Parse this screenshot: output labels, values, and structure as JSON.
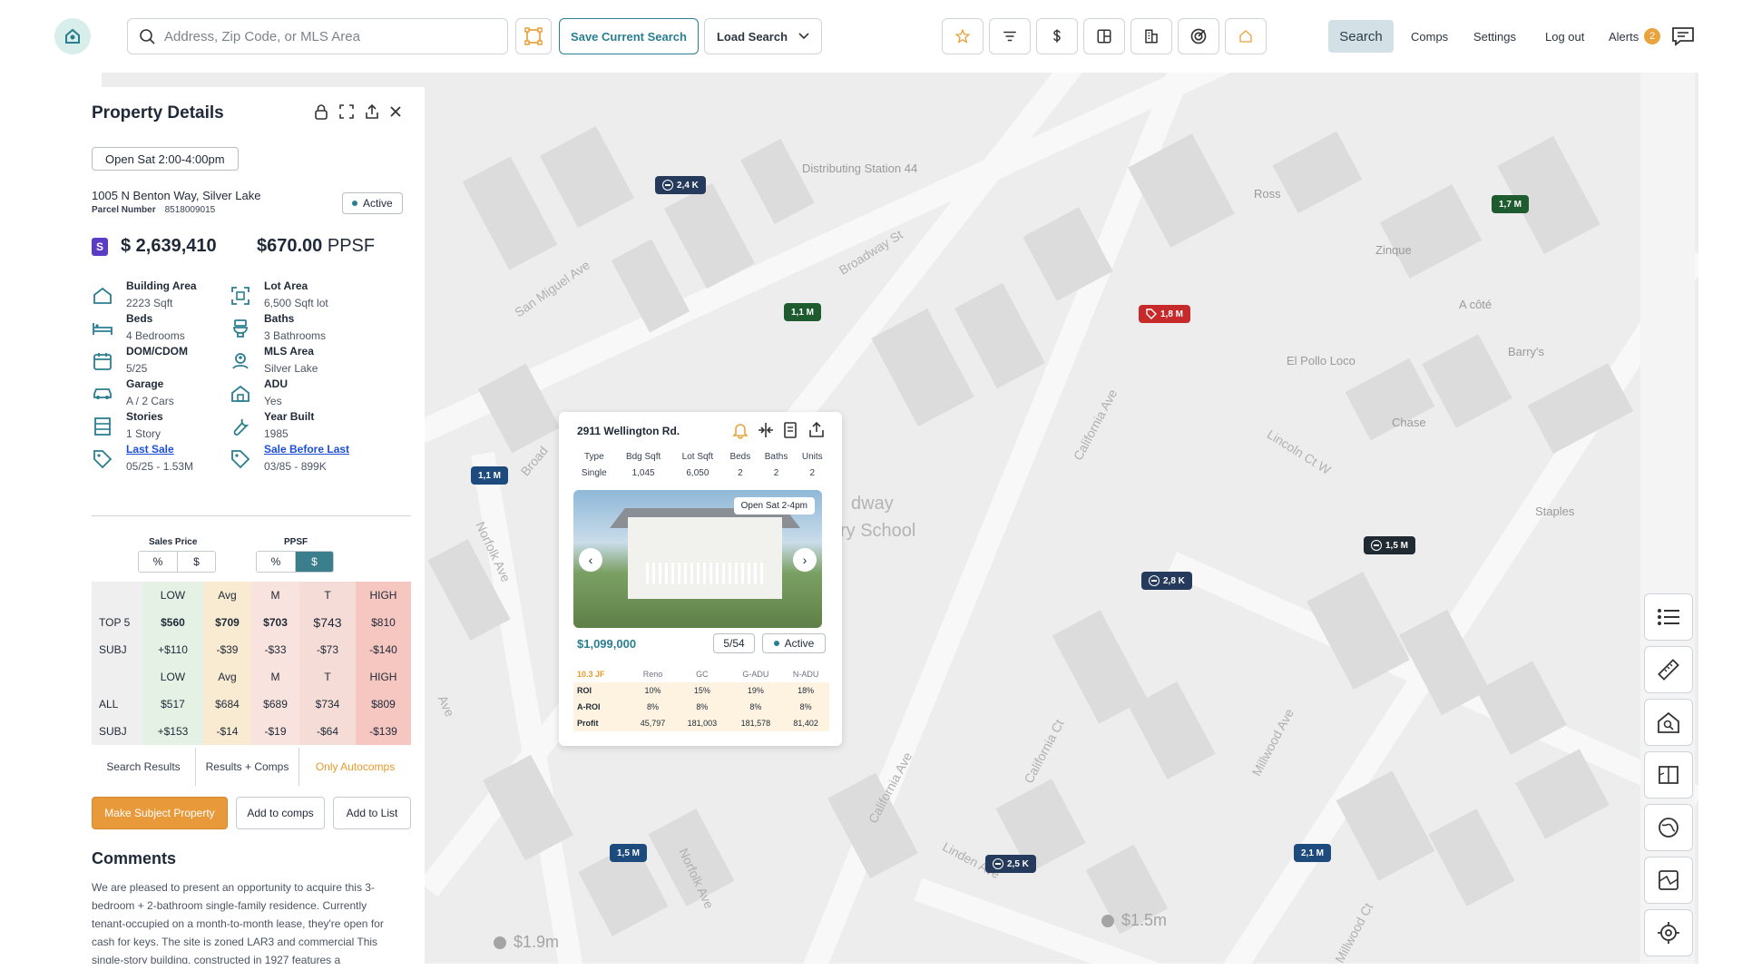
{
  "header": {
    "search_placeholder": "Address, Zip Code, or MLS Area",
    "save_search": "Save Current Search",
    "load_search": "Load Search",
    "nav": {
      "search": "Search",
      "comps": "Comps",
      "settings": "Settings",
      "logout": "Log out",
      "alerts": "Alerts",
      "alerts_count": "2"
    },
    "tools": [
      "star-icon",
      "filter-icon",
      "dollar-icon",
      "layout-icon",
      "building-icon",
      "target-icon",
      "home-outline-icon"
    ]
  },
  "property": {
    "title": "Property Details",
    "open_house": "Open Sat 2:00-4:00pm",
    "address": "1005 N Benton Way, Silver Lake",
    "parcel_label": "Parcel Number",
    "parcel_number": "8518009015",
    "status": "Active",
    "price_badge": "S",
    "price": "$ 2,639,410",
    "ppsf_value": "$670.00",
    "ppsf_unit": "PPSF",
    "details": [
      {
        "label": "Building Area",
        "value": "2223 Sqft"
      },
      {
        "label": "Lot Area",
        "value": "6,500 Sqft lot"
      },
      {
        "label": "Beds",
        "value": "4 Bedrooms"
      },
      {
        "label": "Baths",
        "value": "3 Bathrooms"
      },
      {
        "label": "DOM/CDOM",
        "value": "5/25"
      },
      {
        "label": "MLS Area",
        "value": "Silver Lake"
      },
      {
        "label": "Garage",
        "value": "A / 2 Cars"
      },
      {
        "label": "ADU",
        "value": "Yes"
      },
      {
        "label": "Stories",
        "value": "1 Story"
      },
      {
        "label": "Year Built",
        "value": "1985"
      },
      {
        "label": "Last Sale",
        "value": "05/25 - 1.53M"
      },
      {
        "label": "Sale Before Last",
        "value": "03/85 - 899K"
      }
    ],
    "sales_price_label": "Sales Price",
    "ppsf_label": "PPSF",
    "toggle_pct": "%",
    "toggle_usd": "$",
    "stats": {
      "header": [
        "LOW",
        "Avg",
        "M",
        "T",
        "HIGH"
      ],
      "rows": [
        {
          "label": "TOP 5",
          "values": [
            "$560",
            "$709",
            "$703",
            "$743",
            "$810"
          ]
        },
        {
          "label": "SUBJ",
          "values": [
            "+$110",
            "-$39",
            "-$33",
            "-$73",
            "-$140"
          ]
        },
        {
          "label": "ALL",
          "values": [
            "$517",
            "$684",
            "$689",
            "$734",
            "$809"
          ]
        },
        {
          "label": "SUBJ",
          "values": [
            "+$153",
            "-$14",
            "-$19",
            "-$64",
            "-$139"
          ]
        }
      ]
    },
    "tabs": [
      "Search Results",
      "Results + Comps",
      "Only Autocomps"
    ],
    "buttons": {
      "make_subject": "Make Subject Property",
      "add_comps": "Add to comps",
      "add_list": "Add to List"
    },
    "comments_title": "Comments",
    "comments": "We are pleased to present an opportunity to acquire this 3-bedroom + 2-bathroom single-family residence. Currently tenant-occupied on a month-to-month lease, they're open for cash for keys. The site is zoned LAR3 and commercial This single-story building, constructed in 1927 features a"
  },
  "map": {
    "markers": [
      "2,4 K",
      "1,7 M",
      "1,1 M",
      "1,8 M",
      "1,1 M",
      "1,5 M",
      "2,8 K",
      "1,5 M",
      "2,5 K",
      "2,1 M"
    ],
    "streets": [
      "San Miguel Ave",
      "Broadway St",
      "Broad",
      "Norfolk Ave",
      "California Ave",
      "Lincoln Ct W",
      "California Ct",
      "California Ave",
      "Linden Ave",
      "Millwood Ave",
      "Norfolk Ave",
      "Millwood Ct",
      "Ave"
    ],
    "pois": [
      "Distributing Station 44",
      "Ross",
      "Zinque",
      "A côté",
      "El Pollo Loco",
      "Barry's",
      "Chase",
      "Staples",
      "dway",
      "ry School"
    ],
    "ghost_prices": [
      "$1.9m",
      "$1.5m"
    ]
  },
  "card": {
    "address": "2911 Wellington Rd.",
    "spec_headers": [
      "Type",
      "Bdg Sqft",
      "Lot Sqft",
      "Beds",
      "Baths",
      "Units"
    ],
    "spec_values": [
      "Single",
      "1,045",
      "6,050",
      "2",
      "2",
      "2"
    ],
    "photo_tag": "Open Sat 2-4pm",
    "price": "$1,099,000",
    "count": "5/54",
    "status": "Active",
    "jf": "10.3 JF",
    "roi_headers": [
      "Reno",
      "GC",
      "G-ADU",
      "N-ADU"
    ],
    "roi_rows": [
      {
        "label": "ROI",
        "values": [
          "10%",
          "15%",
          "19%",
          "18%"
        ]
      },
      {
        "label": "A-ROI",
        "values": [
          "8%",
          "8%",
          "8%",
          "8%"
        ]
      },
      {
        "label": "Profit",
        "values": [
          "45,797",
          "181,003",
          "181,578",
          "81,402"
        ]
      }
    ]
  },
  "side_tools": [
    "list-icon",
    "ruler-icon",
    "house-search-icon",
    "map-fold-icon",
    "compass-icon",
    "map-area-icon",
    "locate-icon"
  ],
  "colors": {
    "accent": "#2a7e90",
    "orange": "#e8993a",
    "badge_purple": "#5b3cc4"
  }
}
